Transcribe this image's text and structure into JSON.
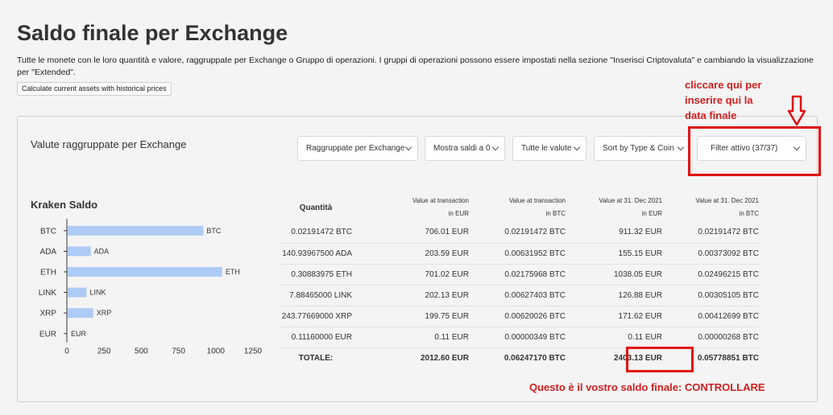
{
  "title": "Saldo finale per Exchange",
  "intro": "Tutte le monete con le loro quantità e valore, raggruppate per Exchange o Gruppo di operazioni. I gruppi di operazioni possono essere impostati nella sezione \"Inserisci Criptovaluta\" e cambiando la visualizzazione per \"Extended\".",
  "historical_button": "Calculate current assets with historical prices",
  "panel": {
    "title": "Valute raggruppate per Exchange",
    "dropdowns": [
      {
        "label": "Raggruppate per Exchange"
      },
      {
        "label": "Mostra saldi a 0"
      },
      {
        "label": "Tutte le valute"
      },
      {
        "label": "Sort by Type & Coin"
      },
      {
        "label": "Filter attivo (37/37)"
      }
    ]
  },
  "chart_title": "Kraken Saldo",
  "chart_data": {
    "type": "bar",
    "orientation": "horizontal",
    "categories": [
      "BTC",
      "ADA",
      "ETH",
      "LINK",
      "XRP",
      "EUR"
    ],
    "bar_labels": [
      "BTC",
      "ADA",
      "ETH",
      "LINK",
      "XRP",
      "EUR"
    ],
    "values": [
      911.32,
      155.15,
      1038.05,
      126.88,
      171.62,
      0.11
    ],
    "xlim": [
      0,
      1250
    ],
    "xticks": [
      "0",
      "250",
      "500",
      "750",
      "1000",
      "1250"
    ],
    "grid": false,
    "colors": {
      "bar": "#aecbf5"
    }
  },
  "table": {
    "headers": {
      "quantity": "Quantità",
      "c1": {
        "line1": "Value at transaction",
        "line2": "in EUR"
      },
      "c2": {
        "line1": "Value at transaction",
        "line2": "in BTC"
      },
      "c3": {
        "line1": "Value at 31. Dec 2021",
        "line2": "in EUR"
      },
      "c4": {
        "line1": "Value at 31. Dec 2021",
        "line2": "in BTC"
      }
    },
    "rows": [
      [
        "0.02191472 BTC",
        "706.01 EUR",
        "0.02191472 BTC",
        "911.32 EUR",
        "0.02191472 BTC"
      ],
      [
        "140.93967500 ADA",
        "203.59 EUR",
        "0.00631952 BTC",
        "155.15 EUR",
        "0.00373092 BTC"
      ],
      [
        "0.30883975 ETH",
        "701.02 EUR",
        "0.02175968 BTC",
        "1038.05 EUR",
        "0.02496215 BTC"
      ],
      [
        "7.88465000 LINK",
        "202.13 EUR",
        "0.00627403 BTC",
        "126.88 EUR",
        "0.00305105 BTC"
      ],
      [
        "243.77669000 XRP",
        "199.75 EUR",
        "0.00620026 BTC",
        "171.62 EUR",
        "0.00412699 BTC"
      ],
      [
        "0.11160000 EUR",
        "0.11 EUR",
        "0.00000349 BTC",
        "0.11 EUR",
        "0.00000268 BTC"
      ]
    ],
    "total": [
      "TOTALE:",
      "2012.60 EUR",
      "0.06247170 BTC",
      "2403.13 EUR",
      "0.05778851 BTC"
    ]
  },
  "annotations": {
    "instruction_line1": "cliccare qui per",
    "instruction_line2": "inserire qui la",
    "instruction_line3": "data finale",
    "note": "Questo è il vostro saldo finale: CONTROLLARE",
    "color": "#d21f1f"
  }
}
